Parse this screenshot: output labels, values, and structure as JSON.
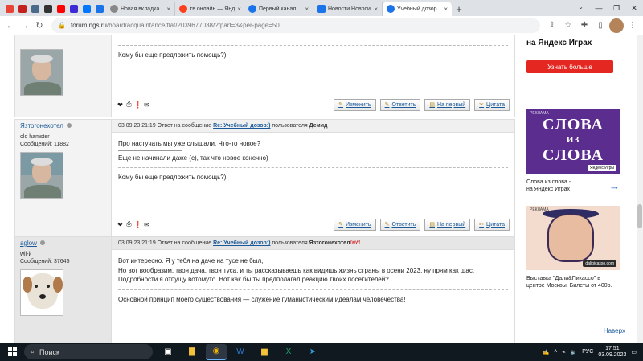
{
  "browser": {
    "tabs": [
      {
        "label": "",
        "icon": "gmail-icon",
        "color": "#ea4335",
        "pinned": true
      },
      {
        "label": "",
        "icon": "mail-icon",
        "color": "#c5221f",
        "pinned": true
      },
      {
        "label": "",
        "icon": "note-icon",
        "color": "#4a6b8a",
        "pinned": true
      },
      {
        "label": "",
        "icon": "close-tab-icon",
        "color": "#333",
        "pinned": true
      },
      {
        "label": "",
        "icon": "youtube-icon",
        "color": "#ff0000",
        "pinned": true
      },
      {
        "label": "",
        "icon": "bookmark-icon",
        "color": "#3d2ad6",
        "pinned": true
      },
      {
        "label": "",
        "icon": "vk-icon",
        "color": "#0077ff",
        "pinned": true
      },
      {
        "label": "",
        "icon": "app-icon",
        "color": "#1a73e8",
        "pinned": true
      },
      {
        "label": "Новая вкладка",
        "icon": "chrome-icon",
        "color": "#888"
      },
      {
        "label": "тв онлайн — Янд",
        "icon": "yandex-icon",
        "color": "#fc3f1d"
      },
      {
        "label": "Первый канал",
        "icon": "globe-icon",
        "color": "#1a73e8"
      },
      {
        "label": "Новости Новоси",
        "icon": "news-icon",
        "color": "#1a73e8"
      },
      {
        "label": "Учебный дозор",
        "icon": "chat-icon",
        "color": "#1a73e8",
        "active": true
      }
    ],
    "url_main": "forum.ngs.ru",
    "url_path": "/board/acquaintance/flat/2039677038/?fpart=3&per-page=50"
  },
  "posts": [
    {
      "author": "",
      "role": "",
      "count": "",
      "header_time": "",
      "reply_prefix": "",
      "reply_link": "",
      "reply_user_prefix": "",
      "reply_user": "",
      "lines": [],
      "signature": "Кому бы еще предложить помощь?)"
    },
    {
      "author": "Язтогонехотел",
      "role": "old hamster",
      "count": "Сообщений: 11882",
      "header_time": "03.09.23 21:19",
      "reply_prefix": "Ответ на сообщение",
      "reply_link": "Re: Учебный дозор:)",
      "reply_user_prefix": "пользователя",
      "reply_user": "Демид",
      "lines": [
        "Про настучать мы уже слышали. Что-то новое?",
        "Еще не начинали даже (с), так что новое конечно)"
      ],
      "signature": "Кому бы еще предложить помощь?)"
    },
    {
      "author": "aglow",
      "role": "wii-й",
      "count": "Сообщений: 37645",
      "header_time": "03.09.23 21:19",
      "reply_prefix": "Ответ на сообщение",
      "reply_link": "Re: Учебный дозор:)",
      "reply_user_prefix": "пользователя",
      "reply_user": "Язтогонехотел",
      "reply_user_new": "new!",
      "lines": [
        "Вот интересно. Я у тебя на даче на тусе не был,",
        "Но вот вообразим, твоя дача, твоя туса, и ты рассказываешь как видишь жизнь страны в осени 2023, ну прям как щас.",
        "Подробности я отпущу вотомуто. Вот как бы ты предполагал реакцию твоих посетителей?"
      ],
      "signature": "Основной принцип моего существования — служение гуманистическим идеалам человечества!"
    }
  ],
  "post_buttons": {
    "change": "Изменить",
    "reply": "Ответить",
    "first": "На первый",
    "quote": "Цитата"
  },
  "ads": {
    "top_title": "на Яндекс Играх",
    "top_button": "Узнать больше",
    "slova_label": "РЕКЛАМА",
    "slova_w1": "СЛОВА",
    "slova_w2": "ИЗ",
    "slova_w3": "СЛОВА",
    "slova_brand": "Яндекс Игры",
    "slova_caption1": "Слова из слова -",
    "slova_caption2": "на Яндекс Играх",
    "dali_label": "РЕКЛАМА",
    "dali_brand": "dalipicasso.com",
    "dali_caption": "Выставка \"Дали&Пикассо\" в центре Москвы. Билеты от 400р.",
    "naverh": "Наверх"
  },
  "taskbar": {
    "search": "Поиск",
    "lang": "РУС",
    "time": "17:51",
    "date": "03.09.2023"
  }
}
